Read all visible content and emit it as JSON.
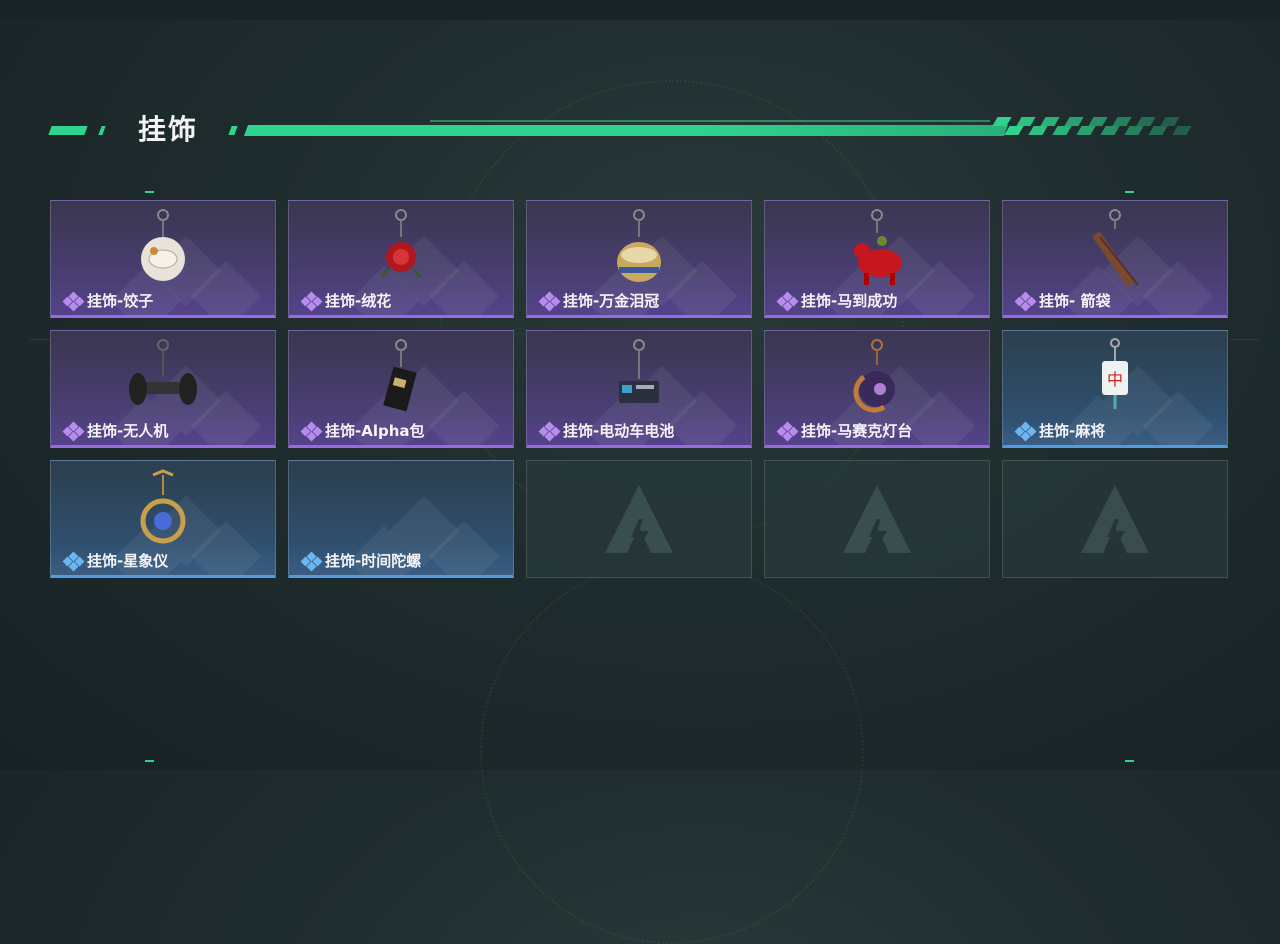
{
  "section": {
    "title": "挂饰"
  },
  "items": [
    {
      "label": "挂饰-饺子",
      "rarity": "purple",
      "icon": "dumpling-pendant-icon"
    },
    {
      "label": "挂饰-绒花",
      "rarity": "purple",
      "icon": "velvet-flower-pendant-icon"
    },
    {
      "label": "挂饰-万金泪冠",
      "rarity": "purple",
      "icon": "gold-crown-pendant-icon"
    },
    {
      "label": "挂饰-马到成功",
      "rarity": "purple",
      "icon": "horse-pendant-icon"
    },
    {
      "label": "挂饰- 箭袋",
      "rarity": "purple",
      "icon": "quiver-pendant-icon"
    },
    {
      "label": "挂饰-无人机",
      "rarity": "purple",
      "icon": "drone-pendant-icon"
    },
    {
      "label": "挂饰-Alpha包",
      "rarity": "purple",
      "icon": "alpha-bag-pendant-icon"
    },
    {
      "label": "挂饰-电动车电池",
      "rarity": "purple",
      "icon": "ev-battery-pendant-icon"
    },
    {
      "label": "挂饰-马赛克灯台",
      "rarity": "purple",
      "icon": "mosaic-lamp-pendant-icon"
    },
    {
      "label": "挂饰-麻将",
      "rarity": "blue",
      "icon": "mahjong-pendant-icon"
    },
    {
      "label": "挂饰-星象仪",
      "rarity": "blue",
      "icon": "astrolabe-pendant-icon"
    },
    {
      "label": "挂饰-时间陀螺",
      "rarity": "blue",
      "icon": "time-gyro-pendant-icon"
    },
    {
      "label": "",
      "rarity": "empty",
      "icon": "empty-slot-logo-icon"
    },
    {
      "label": "",
      "rarity": "empty",
      "icon": "empty-slot-logo-icon"
    },
    {
      "label": "",
      "rarity": "empty",
      "icon": "empty-slot-logo-icon"
    }
  ],
  "colors": {
    "accent": "#2fd38c",
    "purple_rarity": "#9b6ae0",
    "blue_rarity": "#4f9de0"
  }
}
